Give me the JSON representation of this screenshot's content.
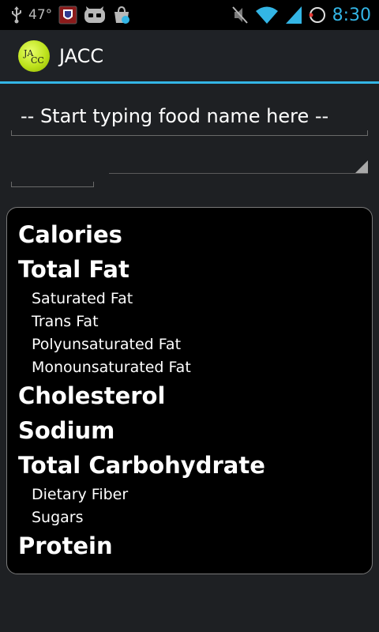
{
  "status_bar": {
    "temperature": "47°",
    "time": "8:30",
    "icons": [
      "usb-icon",
      "nfl-app-icon",
      "cyanogenmod-icon",
      "shopping-bag-icon",
      "mute-icon",
      "wifi-icon",
      "signal-icon",
      "sync-circle-icon"
    ],
    "accent_color": "#33b5e5"
  },
  "action_bar": {
    "logo_line1": "JA",
    "logo_line2": "CC",
    "title": "JACC"
  },
  "search": {
    "placeholder": "-- Start typing food name here --",
    "value": ""
  },
  "quantity": {
    "value": ""
  },
  "unit_spinner": {
    "selected": ""
  },
  "nutrition": {
    "calories": "Calories",
    "total_fat": "Total Fat",
    "saturated_fat": "Saturated Fat",
    "trans_fat": "Trans Fat",
    "polyunsaturated_fat": "Polyunsaturated Fat",
    "monounsaturated_fat": "Monounsaturated Fat",
    "cholesterol": "Cholesterol",
    "sodium": "Sodium",
    "total_carbohydrate": "Total Carbohydrate",
    "dietary_fiber": "Dietary Fiber",
    "sugars": "Sugars",
    "protein": "Protein"
  }
}
